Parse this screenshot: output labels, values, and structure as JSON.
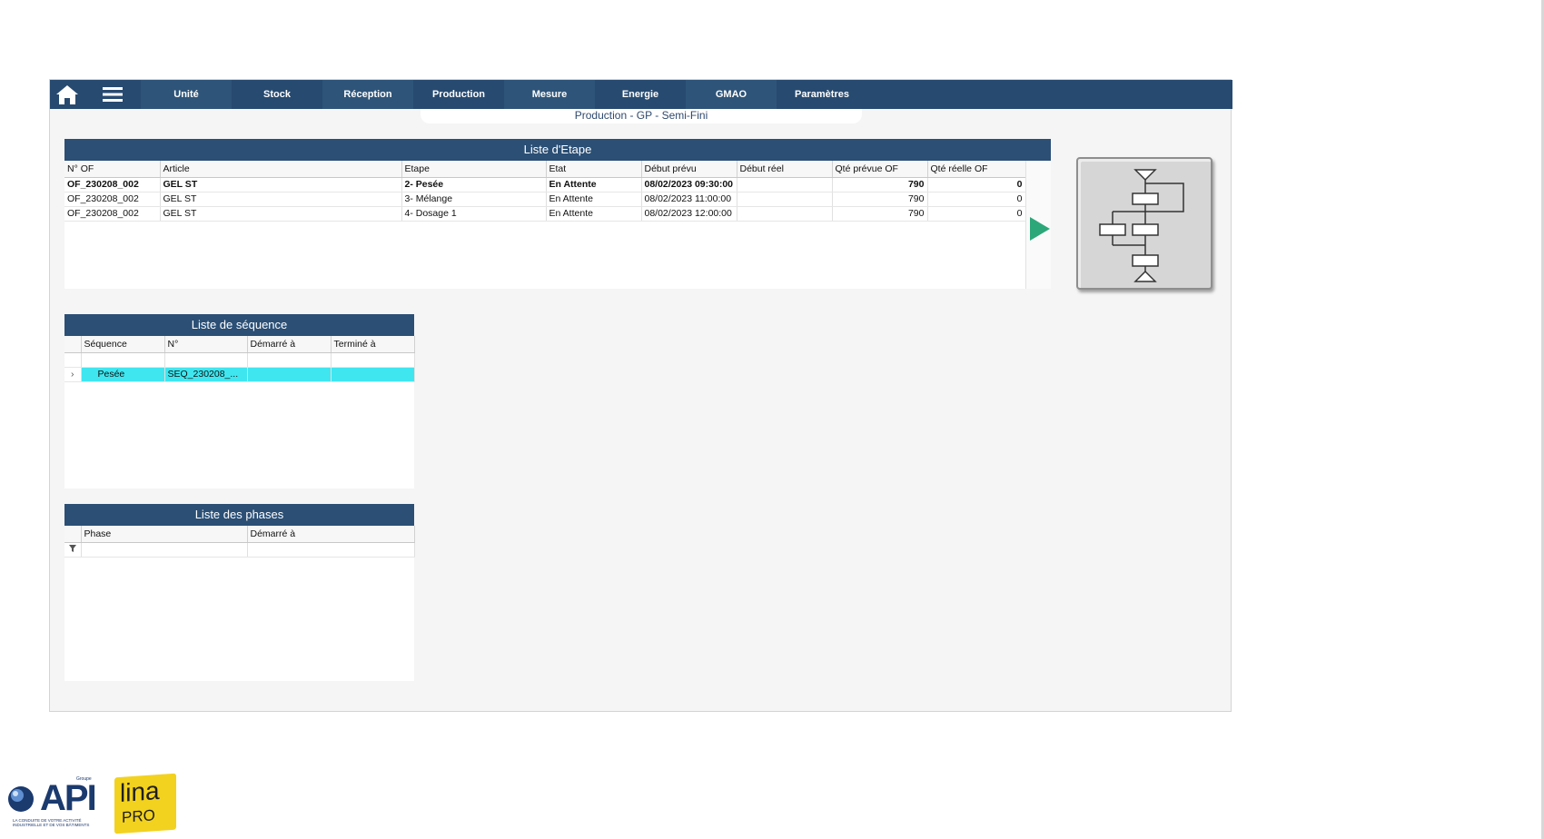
{
  "nav": {
    "items": [
      "Unité",
      "Stock",
      "Réception",
      "Production",
      "Mesure",
      "Energie",
      "GMAO",
      "Paramètres"
    ]
  },
  "page_title": "Production - GP - Semi-Fini",
  "etape": {
    "title": "Liste d'Etape",
    "columns": [
      "N° OF",
      "Article",
      "Etape",
      "Etat",
      "Début prévu",
      "Début réel",
      "Qté prévue OF",
      "Qté réelle OF"
    ],
    "rows": [
      [
        "OF_230208_002",
        "GEL ST",
        "2- Pesée",
        "En Attente",
        "08/02/2023 09:30:00",
        "",
        "790",
        "0"
      ],
      [
        "OF_230208_002",
        "GEL ST",
        "3- Mélange",
        "En Attente",
        "08/02/2023 11:00:00",
        "",
        "790",
        "0"
      ],
      [
        "OF_230208_002",
        "GEL ST",
        "4- Dosage 1",
        "En Attente",
        "08/02/2023 12:00:00",
        "",
        "790",
        "0"
      ]
    ]
  },
  "sequence": {
    "title": "Liste de séquence",
    "columns": [
      "Séquence",
      "N°",
      "Démarré à",
      "Terminé à"
    ],
    "row": {
      "expander": "›",
      "sequence": "Pesée",
      "number": "SEQ_230208_...",
      "started": "",
      "finished": ""
    }
  },
  "phases": {
    "title": "Liste des phases",
    "columns": [
      "Phase",
      "Démarré à"
    ],
    "filter_icon": "filter-icon"
  },
  "logos": {
    "api_text": "API",
    "api_group": "Groupe",
    "api_tagline": "LA CONDUITE DE VOTRE ACTIVITÉ INDUSTRIELLE ET DE VOS BÂTIMENTS",
    "lina_text": "lina",
    "lina_sub": "PRO"
  },
  "colors": {
    "navbar": "#274a70",
    "panel_header": "#2b4f75",
    "selection": "#3fe6ef",
    "play_button": "#2ca77a"
  }
}
